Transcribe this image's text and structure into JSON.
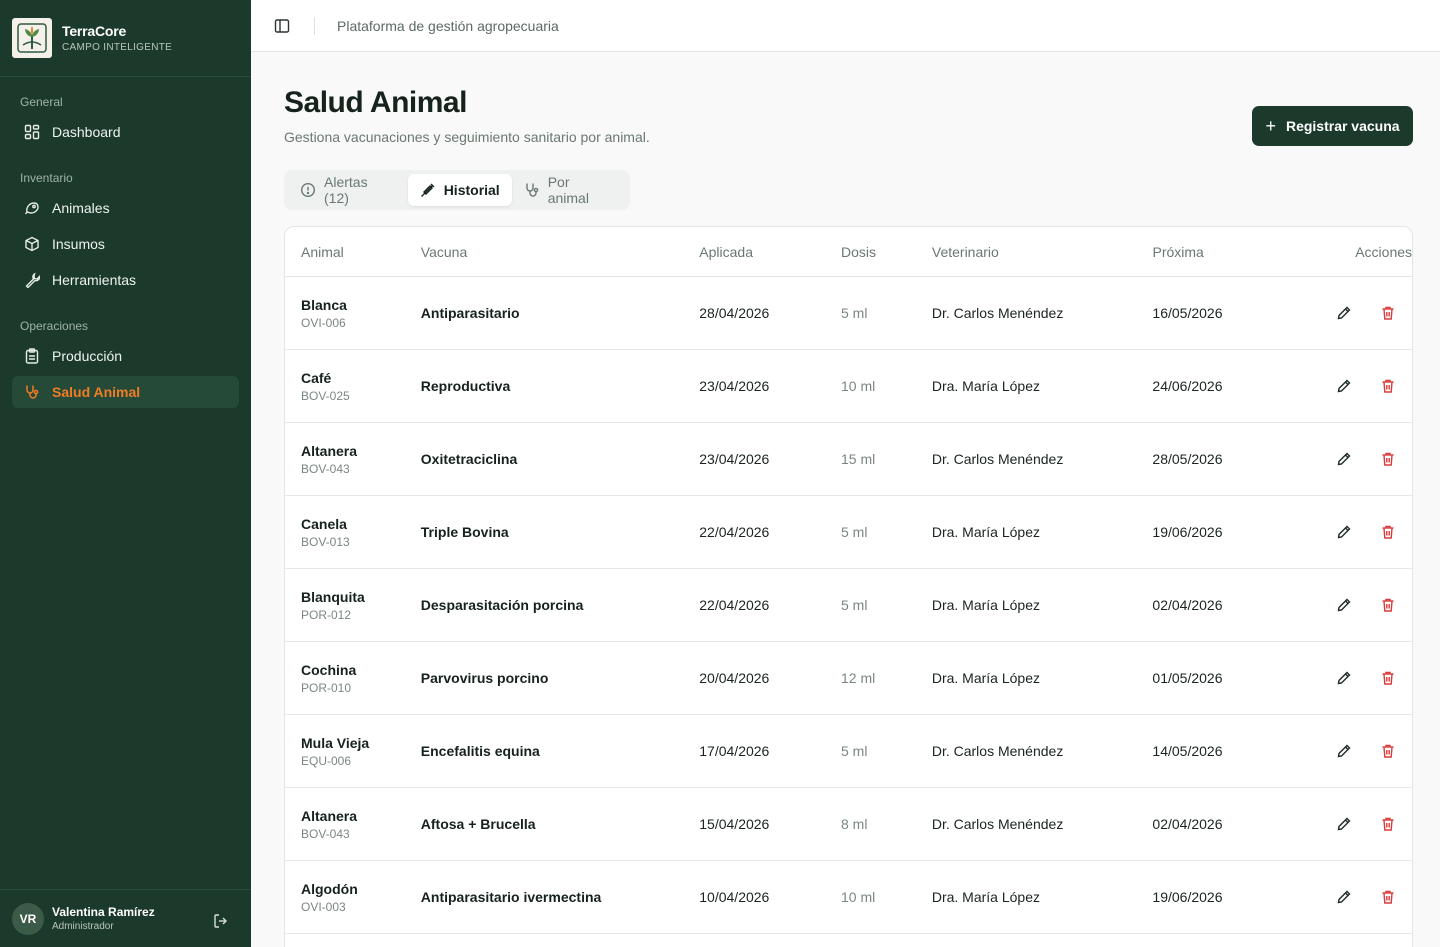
{
  "brand": {
    "name": "TerraCore",
    "tagline": "CAMPO INTELIGENTE"
  },
  "sidebar": {
    "sections": [
      {
        "heading": "General",
        "items": [
          {
            "label": "Dashboard",
            "icon": "dashboard-icon"
          }
        ]
      },
      {
        "heading": "Inventario",
        "items": [
          {
            "label": "Animales",
            "icon": "animal-icon"
          },
          {
            "label": "Insumos",
            "icon": "package-icon"
          },
          {
            "label": "Herramientas",
            "icon": "wrench-icon"
          }
        ]
      },
      {
        "heading": "Operaciones",
        "items": [
          {
            "label": "Producción",
            "icon": "clipboard-icon"
          },
          {
            "label": "Salud Animal",
            "icon": "stethoscope-icon",
            "active": true
          }
        ]
      }
    ]
  },
  "user": {
    "initials": "VR",
    "name": "Valentina Ramírez",
    "role": "Administrador"
  },
  "topbar": {
    "title": "Plataforma de gestión agropecuaria"
  },
  "page": {
    "title": "Salud Animal",
    "subtitle": "Gestiona vacunaciones y seguimiento sanitario por animal.",
    "primary_button": "Registrar vacuna"
  },
  "tabs": [
    {
      "label": "Alertas (12)",
      "icon": "alert-circle-icon",
      "active": false
    },
    {
      "label": "Historial",
      "icon": "syringe-icon",
      "active": true
    },
    {
      "label": "Por animal",
      "icon": "stethoscope-icon",
      "active": false
    }
  ],
  "table": {
    "columns": [
      "Animal",
      "Vacuna",
      "Aplicada",
      "Dosis",
      "Veterinario",
      "Próxima",
      "Acciones"
    ],
    "rows": [
      {
        "animal": "Blanca",
        "code": "OVI-006",
        "vacuna": "Antiparasitario",
        "aplicada": "28/04/2026",
        "dosis": "5 ml",
        "vet": "Dr. Carlos Menéndez",
        "proxima": "16/05/2026"
      },
      {
        "animal": "Café",
        "code": "BOV-025",
        "vacuna": "Reproductiva",
        "aplicada": "23/04/2026",
        "dosis": "10 ml",
        "vet": "Dra. María López",
        "proxima": "24/06/2026"
      },
      {
        "animal": "Altanera",
        "code": "BOV-043",
        "vacuna": "Oxitetraciclina",
        "aplicada": "23/04/2026",
        "dosis": "15 ml",
        "vet": "Dr. Carlos Menéndez",
        "proxima": "28/05/2026"
      },
      {
        "animal": "Canela",
        "code": "BOV-013",
        "vacuna": "Triple Bovina",
        "aplicada": "22/04/2026",
        "dosis": "5 ml",
        "vet": "Dra. María López",
        "proxima": "19/06/2026"
      },
      {
        "animal": "Blanquita",
        "code": "POR-012",
        "vacuna": "Desparasitación porcina",
        "aplicada": "22/04/2026",
        "dosis": "5 ml",
        "vet": "Dra. María López",
        "proxima": "02/04/2026"
      },
      {
        "animal": "Cochina",
        "code": "POR-010",
        "vacuna": "Parvovirus porcino",
        "aplicada": "20/04/2026",
        "dosis": "12 ml",
        "vet": "Dra. María López",
        "proxima": "01/05/2026"
      },
      {
        "animal": "Mula Vieja",
        "code": "EQU-006",
        "vacuna": "Encefalitis equina",
        "aplicada": "17/04/2026",
        "dosis": "5 ml",
        "vet": "Dr. Carlos Menéndez",
        "proxima": "14/05/2026"
      },
      {
        "animal": "Altanera",
        "code": "BOV-043",
        "vacuna": "Aftosa + Brucella",
        "aplicada": "15/04/2026",
        "dosis": "8 ml",
        "vet": "Dr. Carlos Menéndez",
        "proxima": "02/04/2026"
      },
      {
        "animal": "Algodón",
        "code": "OVI-003",
        "vacuna": "Antiparasitario ivermectina",
        "aplicada": "10/04/2026",
        "dosis": "10 ml",
        "vet": "Dra. María López",
        "proxima": "19/06/2026"
      }
    ]
  },
  "colors": {
    "sidebar_bg": "#1b3a2c",
    "active_accent": "#f07d24",
    "delete_red": "#d93a3a",
    "primary": "#1b3a2c"
  }
}
